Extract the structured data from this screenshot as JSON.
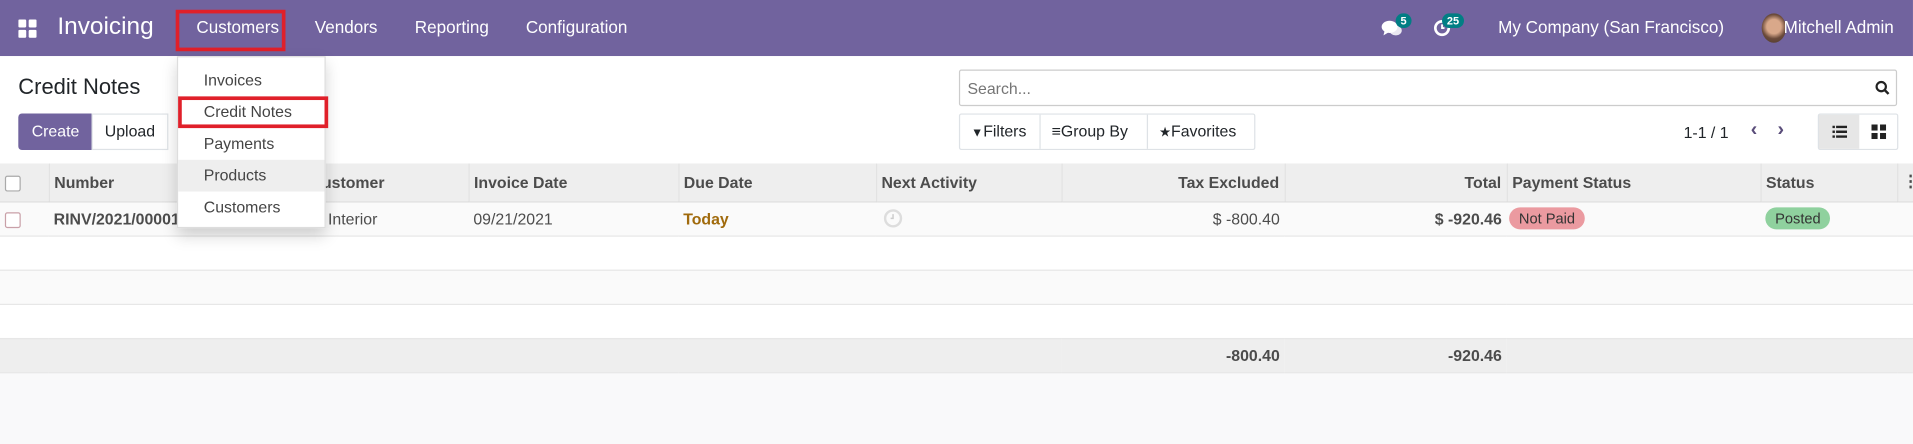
{
  "navbar": {
    "app_title": "Invoicing",
    "menus": [
      "Customers",
      "Vendors",
      "Reporting",
      "Configuration"
    ],
    "messages_count": "5",
    "activities_count": "25",
    "company": "My Company (San Francisco)",
    "user": "Mitchell Admin",
    "color": "#71639e"
  },
  "dropdown": {
    "items": [
      "Invoices",
      "Credit Notes",
      "Payments",
      "Products",
      "Customers"
    ],
    "highlighted": "Credit Notes",
    "hovered": "Products"
  },
  "control": {
    "title": "Credit Notes",
    "create": "Create",
    "upload": "Upload",
    "search_placeholder": "Search...",
    "filters": "Filters",
    "group_by": "Group By",
    "favorites": "Favorites",
    "pager": "1-1 / 1"
  },
  "table": {
    "headers": [
      "Number",
      "Customer",
      "Invoice Date",
      "Due Date",
      "Next Activity",
      "Tax Excluded",
      "Total",
      "Payment Status",
      "Status"
    ],
    "rows": [
      {
        "number": "RINV/2021/00001",
        "customer": "e Interior",
        "invoice_date": "09/21/2021",
        "due_date": "Today",
        "tax_excluded": "$ -800.40",
        "total": "$ -920.46",
        "payment_status": "Not Paid",
        "status": "Posted"
      }
    ],
    "totals": {
      "tax_excluded": "-800.40",
      "total": "-920.46"
    }
  },
  "colors": {
    "primary": "#71639e",
    "not_paid": "#eb9aa0",
    "posted": "#8fd19e",
    "today": "#a06a0c",
    "highlight_box": "#e0202a"
  }
}
